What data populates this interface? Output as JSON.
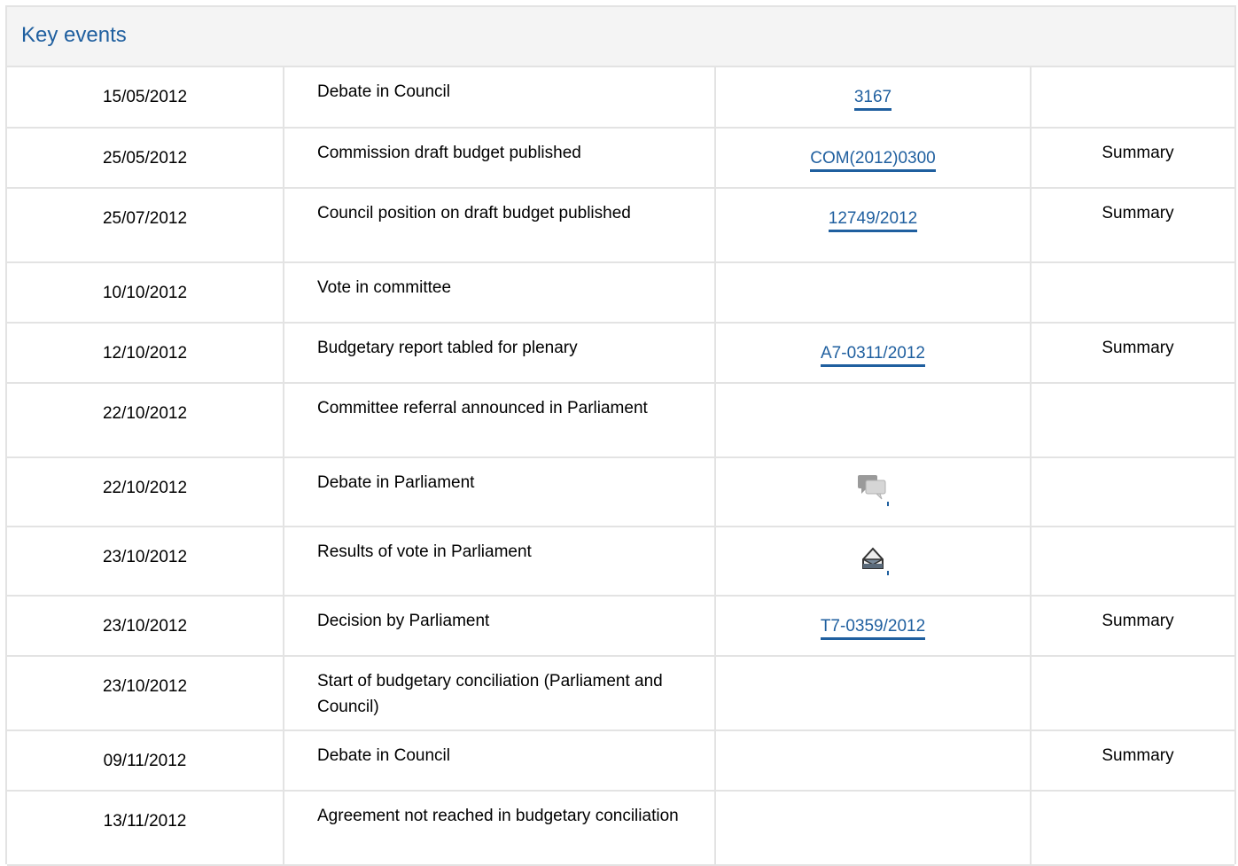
{
  "section": {
    "title": "Key events"
  },
  "colors": {
    "link": "#1f5f9f",
    "border": "#e3e3e3",
    "header_bg": "#f4f4f4"
  },
  "events": [
    {
      "date": "15/05/2012",
      "event": "Debate in Council",
      "ref": "3167",
      "ref_type": "link",
      "summary": ""
    },
    {
      "date": "25/05/2012",
      "event": "Commission draft budget published",
      "ref": "COM(2012)0300",
      "ref_type": "link",
      "summary": "Summary"
    },
    {
      "date": "25/07/2012",
      "event": "Council position on draft budget published",
      "ref": "12749/2012",
      "ref_type": "link",
      "summary": "Summary"
    },
    {
      "date": "10/10/2012",
      "event": "Vote in committee",
      "ref": "",
      "ref_type": "none",
      "summary": ""
    },
    {
      "date": "12/10/2012",
      "event": "Budgetary report tabled for plenary",
      "ref": "A7-0311/2012",
      "ref_type": "link",
      "summary": "Summary"
    },
    {
      "date": "22/10/2012",
      "event": "Committee referral announced in Parliament",
      "ref": "",
      "ref_type": "none",
      "summary": ""
    },
    {
      "date": "22/10/2012",
      "event": "Debate in Parliament",
      "ref": "",
      "ref_type": "debate-icon",
      "summary": ""
    },
    {
      "date": "23/10/2012",
      "event": "Results of vote in Parliament",
      "ref": "",
      "ref_type": "vote-icon",
      "summary": ""
    },
    {
      "date": "23/10/2012",
      "event": "Decision by Parliament",
      "ref": "T7-0359/2012",
      "ref_type": "link",
      "summary": "Summary"
    },
    {
      "date": "23/10/2012",
      "event": "Start of budgetary conciliation (Parliament and Council)",
      "ref": "",
      "ref_type": "none",
      "summary": ""
    },
    {
      "date": "09/11/2012",
      "event": "Debate in Council",
      "ref": "",
      "ref_type": "none",
      "summary": "Summary"
    },
    {
      "date": "13/11/2012",
      "event": "Agreement not reached in budgetary conciliation",
      "ref": "",
      "ref_type": "none",
      "summary": ""
    }
  ]
}
